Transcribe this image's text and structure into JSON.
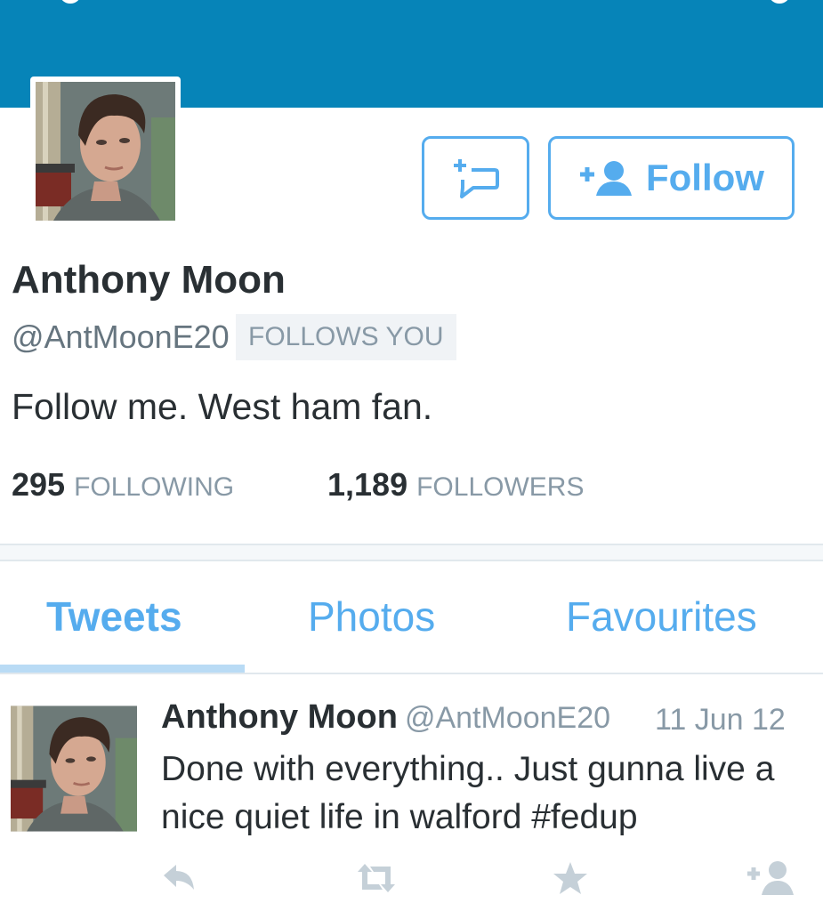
{
  "profile": {
    "name": "Anthony Moon",
    "handle": "@AntMoonE20",
    "follows_you_badge": "FOLLOWS YOU",
    "bio": "Follow me. West ham fan.",
    "following_count": "295",
    "following_label": "FOLLOWING",
    "followers_count": "1,189",
    "followers_label": "FOLLOWERS"
  },
  "actions": {
    "follow_label": "Follow",
    "message_icon": "new-message-icon",
    "follow_icon": "add-user-icon"
  },
  "tabs": [
    {
      "label": "Tweets",
      "active": true
    },
    {
      "label": "Photos",
      "active": false
    },
    {
      "label": "Favourites",
      "active": false
    }
  ],
  "tweet": {
    "name": "Anthony Moon",
    "handle": "@AntMoonE20",
    "date": "11 Jun 12",
    "text": "Done with everything.. Just gunna live a nice quiet life in walford #fedup",
    "actions": [
      "reply-icon",
      "retweet-icon",
      "favorite-icon",
      "follow-user-icon"
    ]
  },
  "colors": {
    "header": "#0684b8",
    "accent": "#55acee",
    "muted": "#8899a6",
    "text": "#292f33"
  }
}
